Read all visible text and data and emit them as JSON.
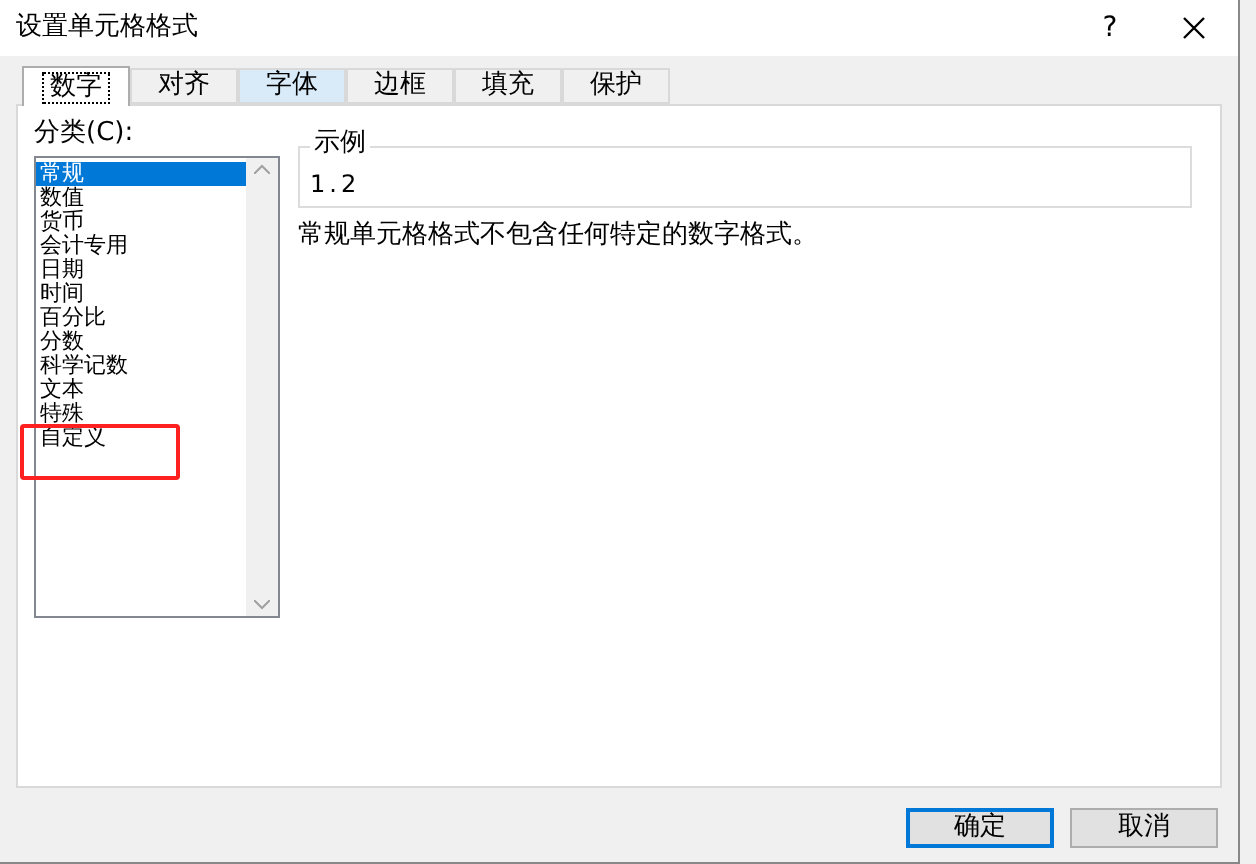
{
  "window": {
    "title": "设置单元格格式",
    "help_button": "?"
  },
  "tabs": [
    {
      "label": "数字",
      "selected": true,
      "hovered": false
    },
    {
      "label": "对齐",
      "selected": false,
      "hovered": false
    },
    {
      "label": "字体",
      "selected": false,
      "hovered": true
    },
    {
      "label": "边框",
      "selected": false,
      "hovered": false
    },
    {
      "label": "填充",
      "selected": false,
      "hovered": false
    },
    {
      "label": "保护",
      "selected": false,
      "hovered": false
    }
  ],
  "category": {
    "label": "分类(C):",
    "items": [
      {
        "label": "常规",
        "selected": true
      },
      {
        "label": "数值",
        "selected": false
      },
      {
        "label": "货币",
        "selected": false
      },
      {
        "label": "会计专用",
        "selected": false
      },
      {
        "label": "日期",
        "selected": false
      },
      {
        "label": "时间",
        "selected": false
      },
      {
        "label": "百分比",
        "selected": false
      },
      {
        "label": "分数",
        "selected": false
      },
      {
        "label": "科学记数",
        "selected": false
      },
      {
        "label": "文本",
        "selected": false
      },
      {
        "label": "特殊",
        "selected": false
      },
      {
        "label": "自定义",
        "selected": false
      }
    ]
  },
  "sample": {
    "label": "示例",
    "value": "1.2"
  },
  "description": "常规单元格格式不包含任何特定的数字格式。",
  "buttons": [
    {
      "label": "确定",
      "default": true
    },
    {
      "label": "取消",
      "default": false
    }
  ]
}
